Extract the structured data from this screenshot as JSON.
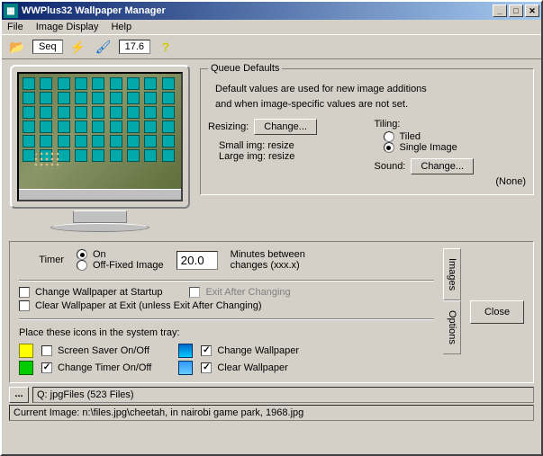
{
  "title": "WWPlus32 Wallpaper Manager",
  "menu": {
    "file": "File",
    "image_display": "Image Display",
    "help": "Help"
  },
  "toolbar": {
    "seq_label": "Seq",
    "interval_value": "17.6"
  },
  "queue_defaults": {
    "title": "Queue Defaults",
    "desc1": "Default values are used for new image additions",
    "desc2": "and when image-specific values are not set.",
    "resizing_label": "Resizing:",
    "change_btn": "Change...",
    "small_img": "Small img: resize",
    "large_img": "Large img: resize",
    "tiling_label": "Tiling:",
    "tiled": "Tiled",
    "single": "Single Image",
    "sound_label": "Sound:",
    "sound_change": "Change...",
    "sound_value": "(None)"
  },
  "timer": {
    "label": "Timer",
    "on": "On",
    "off_fixed": "Off-Fixed Image",
    "value": "20.0",
    "minutes1": "Minutes between",
    "minutes2": "changes (xxx.x)"
  },
  "options": {
    "change_startup": "Change Wallpaper at Startup",
    "exit_after": "Exit After Changing",
    "clear_exit": "Clear Wallpaper at Exit (unless Exit After Changing)"
  },
  "tray": {
    "title": "Place these icons in the system tray:",
    "screensaver": "Screen Saver On/Off",
    "change_timer": "Change Timer On/Off",
    "change_wall": "Change Wallpaper",
    "clear_wall": "Clear Wallpaper"
  },
  "tabs": {
    "images": "Images",
    "options": "Options"
  },
  "close_btn": "Close",
  "queue_status": "Q: jpgFiles (523 Files)",
  "current_image": "Current Image: n:\\files.jpg\\cheetah, in nairobi game park, 1968.jpg"
}
